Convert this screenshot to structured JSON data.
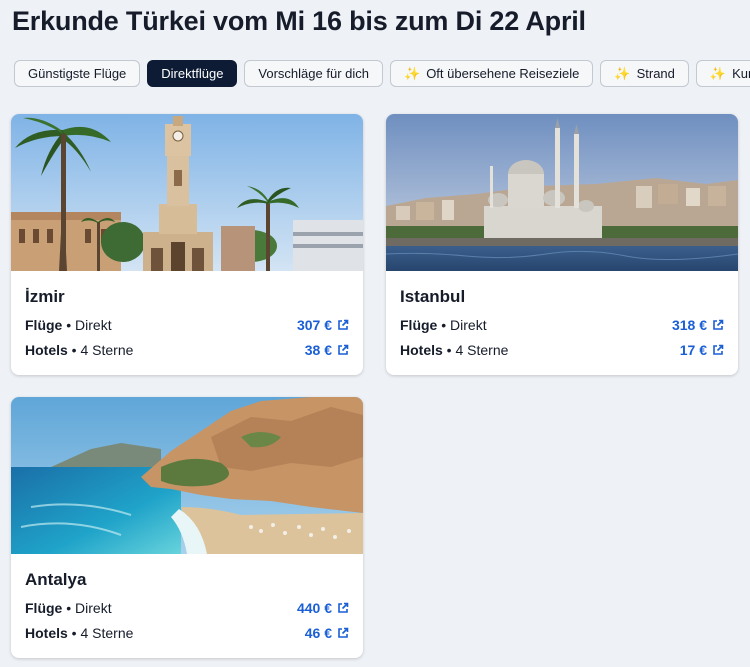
{
  "page": {
    "title": "Erkunde Türkei vom Mi 16 bis zum Di 22 April"
  },
  "chips": [
    {
      "label": "Günstigste Flüge",
      "active": false,
      "sparkle": false
    },
    {
      "label": "Direktflüge",
      "active": true,
      "sparkle": false
    },
    {
      "label": "Vorschläge für dich",
      "active": false,
      "sparkle": false
    },
    {
      "label": "Oft übersehene Reiseziele",
      "active": false,
      "sparkle": true
    },
    {
      "label": "Strand",
      "active": false,
      "sparkle": true
    },
    {
      "label": "Kunst",
      "active": false,
      "sparkle": true
    }
  ],
  "sparkle_glyph": "✨",
  "cards": [
    {
      "city": "İzmir",
      "image": "izmir-clock-tower-photo",
      "flights": {
        "label": "Flüge",
        "sep": " • ",
        "detail": "Direkt",
        "price": "307 €"
      },
      "hotels": {
        "label": "Hotels",
        "sep": " • ",
        "detail": "4 Sterne",
        "price": "38 €"
      }
    },
    {
      "city": "Istanbul",
      "image": "istanbul-mosque-skyline-photo",
      "flights": {
        "label": "Flüge",
        "sep": " • ",
        "detail": "Direkt",
        "price": "318 €"
      },
      "hotels": {
        "label": "Hotels",
        "sep": " • ",
        "detail": "4 Sterne",
        "price": "17 €"
      }
    },
    {
      "city": "Antalya",
      "image": "antalya-beach-cliff-photo",
      "flights": {
        "label": "Flüge",
        "sep": " • ",
        "detail": "Direkt",
        "price": "440 €"
      },
      "hotels": {
        "label": "Hotels",
        "sep": " • ",
        "detail": "4 Sterne",
        "price": "46 €"
      }
    }
  ],
  "colors": {
    "background": "#eef1f6",
    "active_chip": "#0d1b34",
    "price": "#1a5fd6",
    "sparkle": "#f2b705"
  },
  "icons": {
    "external_link": "external-link-icon"
  }
}
